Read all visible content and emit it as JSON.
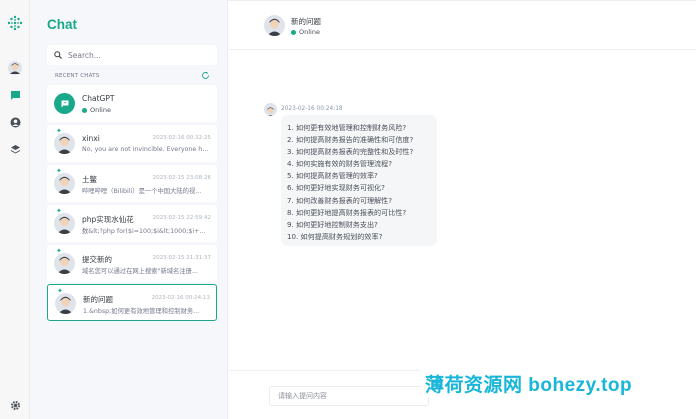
{
  "rail": {
    "icons": [
      "logo-icon",
      "user-avatar-icon",
      "chat-icon",
      "profile-icon",
      "layers-icon",
      "settings-icon"
    ]
  },
  "sidebar": {
    "title": "Chat",
    "search_placeholder": "Search...",
    "recent_label": "RECENT CHATS"
  },
  "chats": [
    {
      "name": "ChatGPT",
      "status": "Online"
    },
    {
      "name": "xinxi",
      "date": "2023-02-16 00:32:25",
      "preview": "No, you are not invincible. Everyone has..."
    },
    {
      "name": "土鳖",
      "date": "2023-02-15 23:08:26",
      "preview": "哔哩哔哩（Bilibili）是一个中国大陆的视..."
    },
    {
      "name": "php实现水仙花",
      "date": "2023-02-15 22:59:42",
      "preview": "数&lt;?php for($i=100;$i&lt;1000;$i++)..."
    },
    {
      "name": "提交新的",
      "date": "2023-02-15 21:31:37",
      "preview": "域名您可以通过在网上搜索\"新域名注册..."
    },
    {
      "name": "新的问题",
      "date": "2023-02-16 00:24:13",
      "preview": "1.&nbsp;如何更有效地管理和控制财务..."
    }
  ],
  "conversation": {
    "title": "新的问题",
    "status": "Online",
    "message_time": "2023-02-16 00:24:18",
    "message_lines": [
      "1. 如何更有效地管理和控制财务风险?",
      "2. 如何提高财务报告的准确性和可信度?",
      "3. 如何提高财务报表的完整性和及时性?",
      "4. 如何实施有效的财务管理流程?",
      "5. 如何提高财务管理的效率?",
      "6. 如何更好地实现财务可视化?",
      "7. 如何改善财务报表的可理解性?",
      "8. 如何更好地提高财务报表的可比性?",
      "9. 如何更好地控制财务支出?",
      "10. 如何提高财务规划的效率?"
    ],
    "input_placeholder": "请输入提问内容"
  },
  "watermark": "薄荷资源网 bohezy.top",
  "colors": {
    "accent": "#19a88a",
    "watermark": "#18b6d8"
  }
}
